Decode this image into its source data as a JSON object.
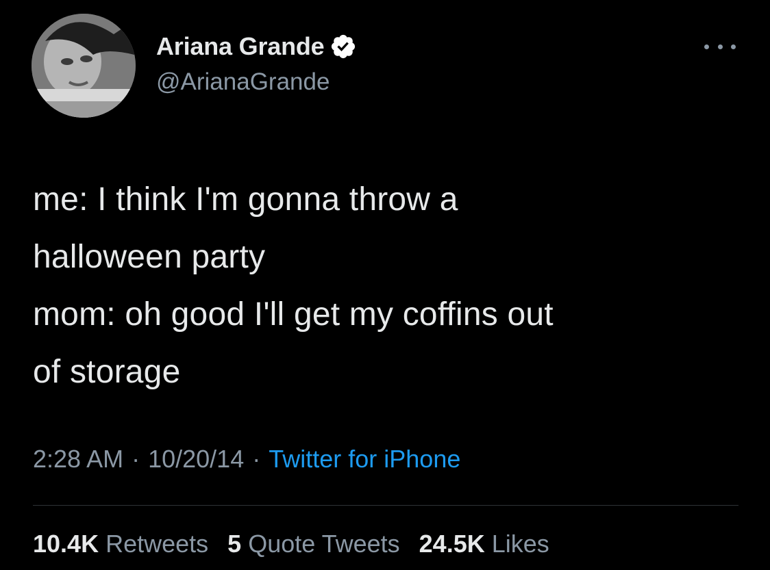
{
  "author": {
    "display_name": "Ariana Grande",
    "handle": "@ArianaGrande",
    "verified": true
  },
  "tweet": {
    "text": "me: I think I'm gonna throw a\nhalloween party\nmom: oh good I'll get my coffins out\nof storage"
  },
  "meta": {
    "time": "2:28 AM",
    "separator": "·",
    "date": "10/20/14",
    "source": "Twitter for iPhone"
  },
  "stats": {
    "retweets_count": "10.4K",
    "retweets_label": "Retweets",
    "quotes_count": "5",
    "quotes_label": "Quote Tweets",
    "likes_count": "24.5K",
    "likes_label": "Likes"
  },
  "colors": {
    "background": "#000000",
    "primary_text": "#e7e9ea",
    "secondary_text": "#8b98a5",
    "accent": "#1d9bf0",
    "divider": "#2f3336"
  },
  "icons": {
    "verified": "verified-badge-icon",
    "more": "more-options-icon"
  }
}
